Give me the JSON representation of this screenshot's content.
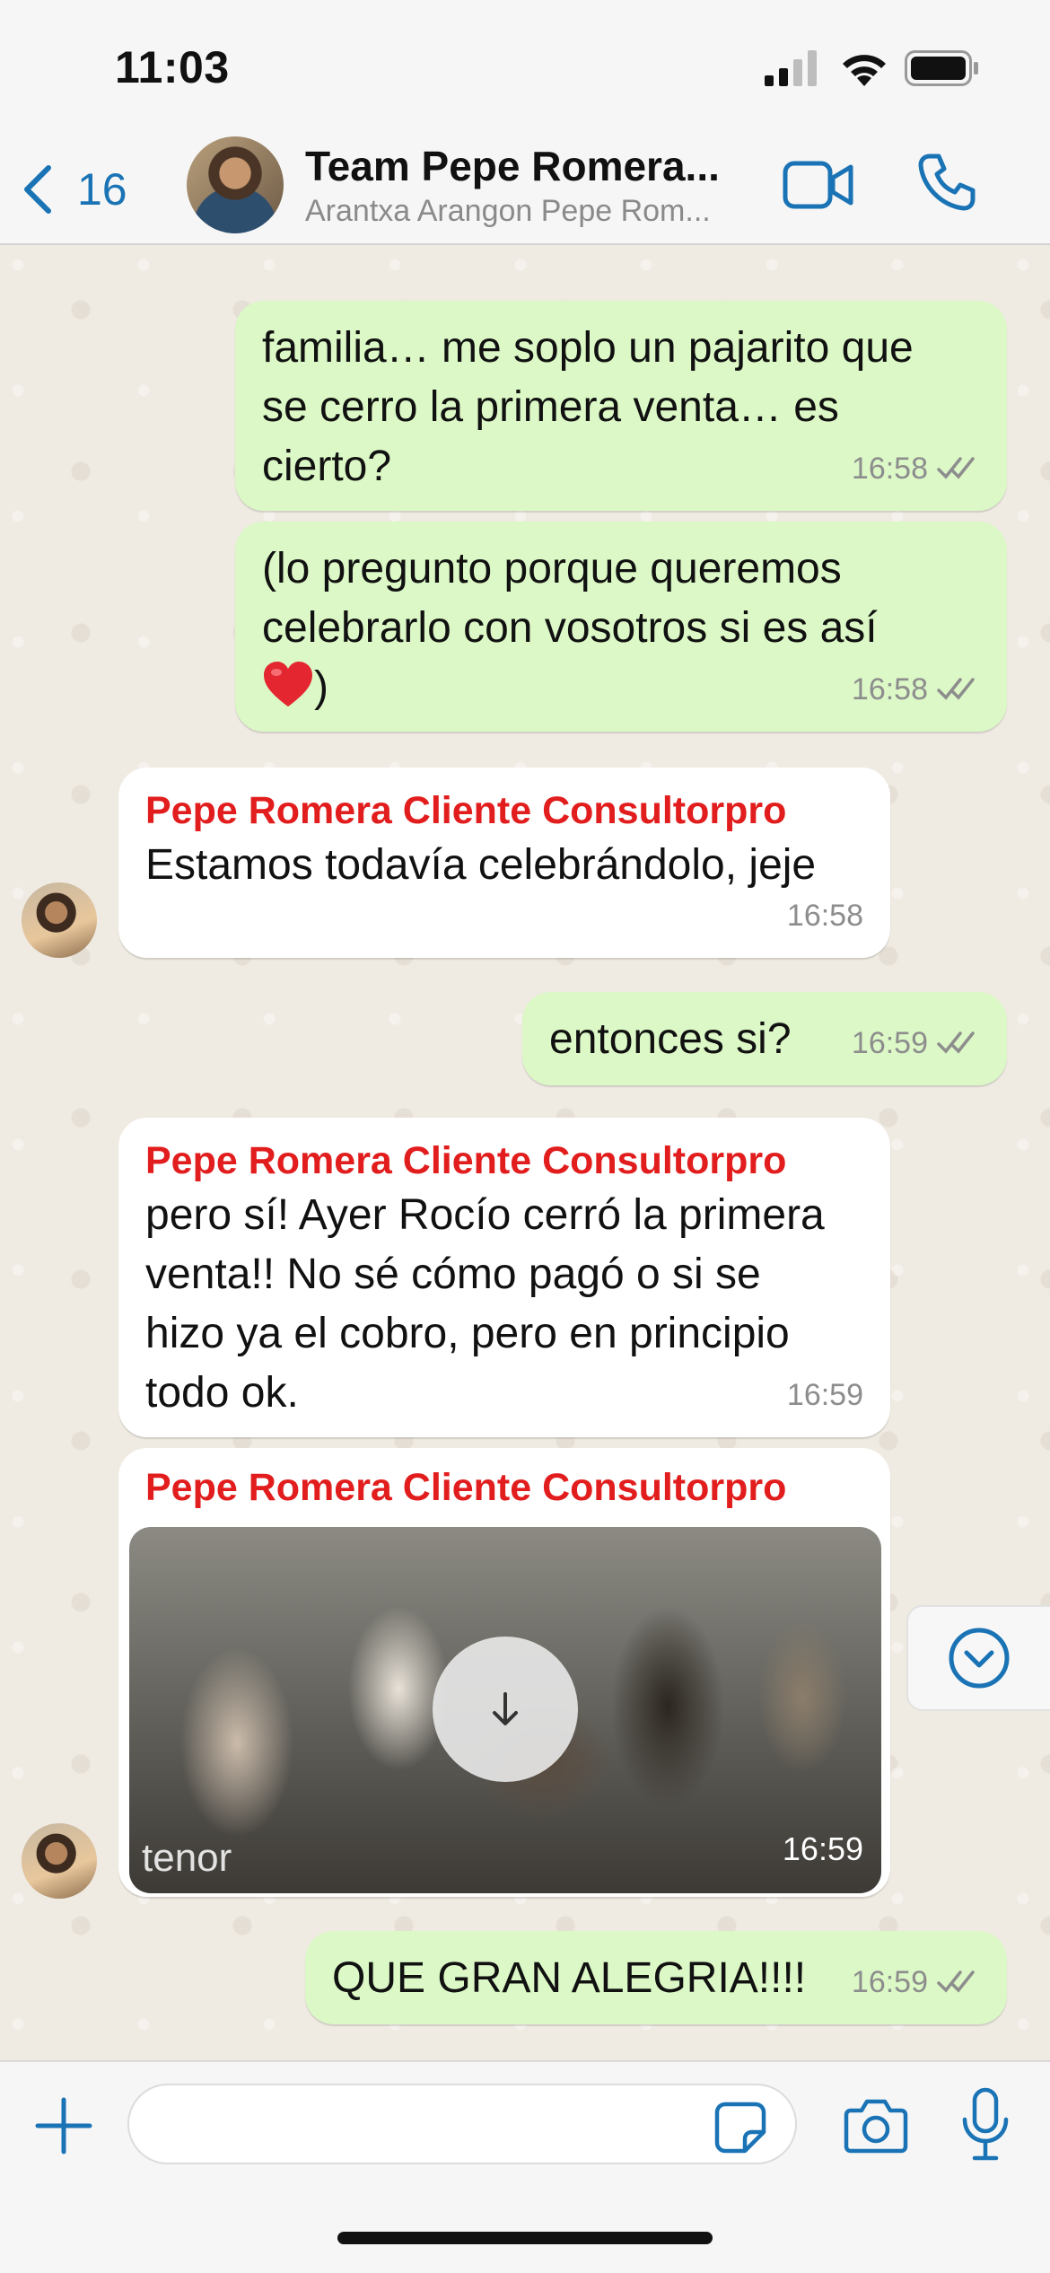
{
  "status_bar": {
    "time": "11:03"
  },
  "header": {
    "back_count": "16",
    "title": "Team Pepe Romera...",
    "subtitle": "Arantxa Arangon Pepe Rom..."
  },
  "messages": [
    {
      "id": "m1",
      "direction": "outgoing",
      "lines": [
        "familia… me soplo un pajarito que",
        "se cerro la primera venta… es",
        "cierto?"
      ],
      "time": "16:58",
      "status": "read"
    },
    {
      "id": "m2",
      "direction": "outgoing",
      "lines": [
        "(lo pregunto porque queremos",
        "celebrarlo con vosotros si es así",
        ")"
      ],
      "emoji": "red-heart",
      "time": "16:58",
      "status": "read"
    },
    {
      "id": "m3",
      "direction": "incoming",
      "sender": "Pepe Romera Cliente Consultorpro",
      "lines": [
        "Estamos todavía celebrándolo, jeje"
      ],
      "time": "16:58"
    },
    {
      "id": "m4",
      "direction": "outgoing",
      "lines": [
        "entonces si?"
      ],
      "time": "16:59",
      "status": "read"
    },
    {
      "id": "m5",
      "direction": "incoming",
      "sender": "Pepe Romera Cliente Consultorpro",
      "lines": [
        "pero sí! Ayer Rocío cerró la primera",
        "venta!! No sé cómo pagó o si se",
        "hizo ya el cobro, pero en principio",
        "todo ok."
      ],
      "time": "16:59"
    },
    {
      "id": "m6",
      "direction": "incoming",
      "sender": "Pepe Romera Cliente Consultorpro",
      "media": {
        "type": "gif",
        "watermark": "tenor",
        "action": "download"
      },
      "time": "16:59"
    },
    {
      "id": "m7",
      "direction": "outgoing",
      "lines": [
        "QUE GRAN ALEGRIA!!!!"
      ],
      "time": "16:59",
      "status": "read"
    }
  ],
  "composer": {
    "placeholder": ""
  },
  "colors": {
    "outgoing_bubble": "#dbf8c6",
    "incoming_bubble": "#ffffff",
    "sender_name": "#e21d1d",
    "accent": "#1a73b5",
    "chat_background": "#efeae2"
  },
  "icons": [
    "signal-icon",
    "wifi-icon",
    "battery-icon",
    "back-chevron-icon",
    "video-call-icon",
    "phone-icon",
    "double-check-icon",
    "download-icon",
    "scroll-down-icon",
    "plus-icon",
    "sticker-icon",
    "camera-icon",
    "microphone-icon"
  ]
}
